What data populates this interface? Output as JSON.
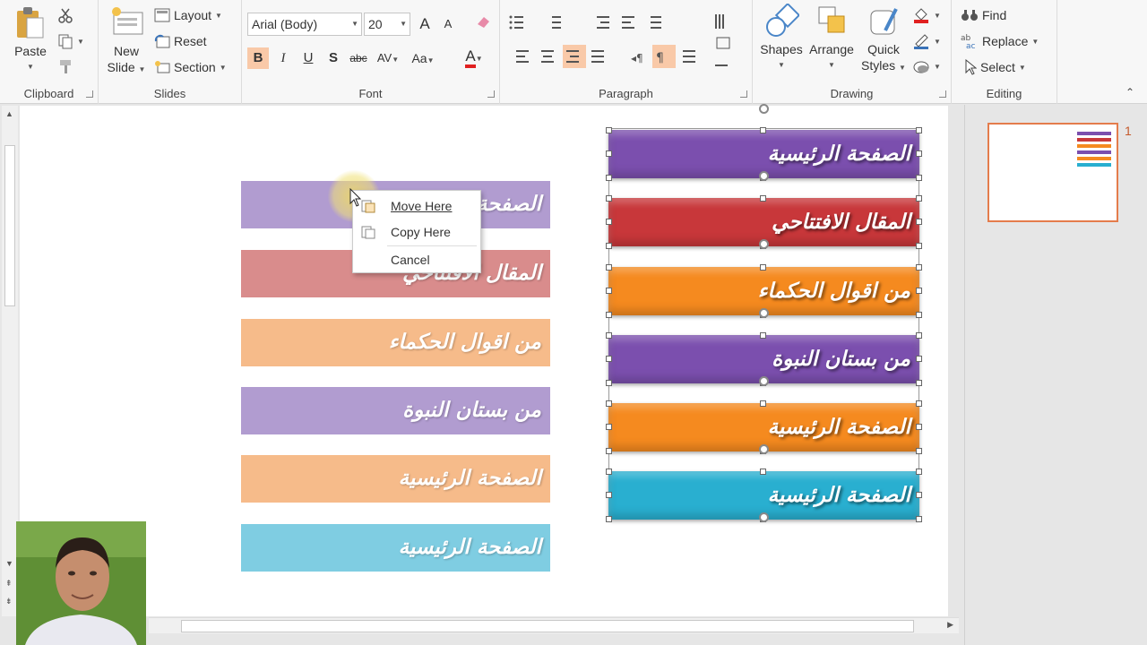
{
  "ribbon": {
    "clipboard": {
      "label": "Clipboard",
      "paste": "Paste"
    },
    "slides": {
      "label": "Slides",
      "new_slide_line1": "New",
      "new_slide_line2": "Slide",
      "layout": "Layout",
      "reset": "Reset",
      "section": "Section"
    },
    "font": {
      "label": "Font",
      "font_name": "Arial (Body)",
      "font_size": "20",
      "bold": "B",
      "italic": "I",
      "underline": "U",
      "shadow": "S",
      "strike": "abc",
      "spacing": "AV",
      "case": "Aa",
      "grow": "A",
      "shrink": "A",
      "color": "A"
    },
    "paragraph": {
      "label": "Paragraph"
    },
    "drawing": {
      "label": "Drawing",
      "shapes": "Shapes",
      "arrange": "Arrange",
      "quick_styles_line1": "Quick",
      "quick_styles_line2": "Styles"
    },
    "editing": {
      "label": "Editing",
      "find": "Find",
      "replace": "Replace",
      "select": "Select"
    }
  },
  "slide": {
    "left_bars": [
      {
        "text": "الصفحة الرئيسية",
        "color": "#b19cd0"
      },
      {
        "text": "المقال الافتتاحي",
        "color": "#d98c8c"
      },
      {
        "text": "من اقوال الحكماء",
        "color": "#f6bb8a"
      },
      {
        "text": "من بستان النبوة",
        "color": "#b19cd0"
      },
      {
        "text": "الصفحة الرئيسية",
        "color": "#f6bb8a"
      },
      {
        "text": "الصفحة الرئيسية",
        "color": "#7fcde2"
      }
    ],
    "right_bars": [
      {
        "text": "الصفحة الرئيسية",
        "color": "#7b4fae"
      },
      {
        "text": "المقال الافتتاحي",
        "color": "#c8373a"
      },
      {
        "text": "من اقوال الحكماء",
        "color": "#f58a1f"
      },
      {
        "text": "من بستان النبوة",
        "color": "#7b4fae"
      },
      {
        "text": "الصفحة الرئيسية",
        "color": "#f58a1f"
      },
      {
        "text": "الصفحة الرئيسية",
        "color": "#29afd0"
      }
    ]
  },
  "context_menu": {
    "move_here": "Move Here",
    "copy_here": "Copy Here",
    "cancel": "Cancel"
  },
  "thumbnails": {
    "slide_number": "1"
  }
}
